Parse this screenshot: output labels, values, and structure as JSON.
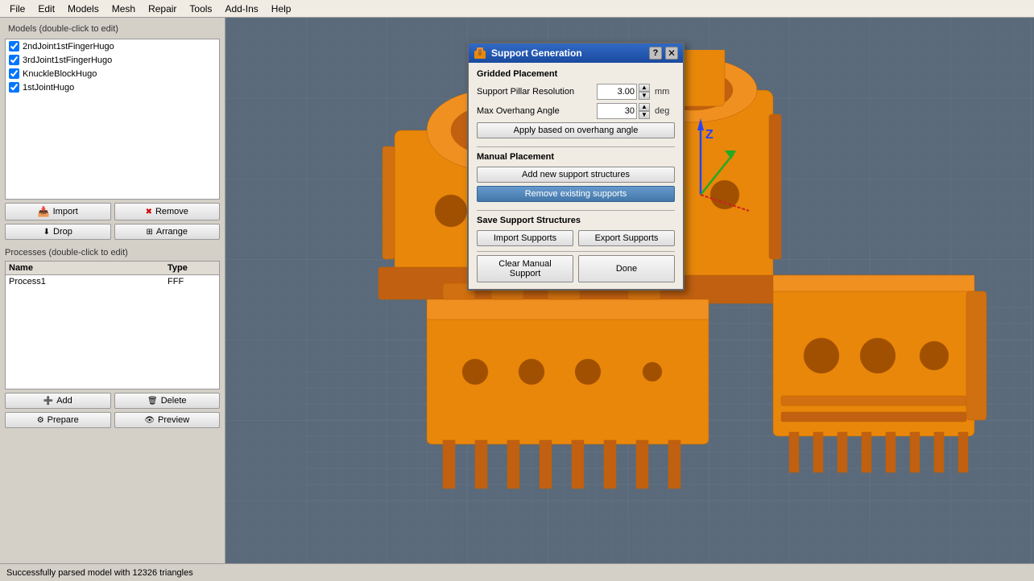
{
  "menubar": {
    "items": [
      "File",
      "Edit",
      "Models",
      "Mesh",
      "Repair",
      "Tools",
      "Add-Ins",
      "Help"
    ]
  },
  "leftpanel": {
    "models_title": "Models (double-click to edit)",
    "models": [
      {
        "label": "2ndJoint1stFingerHugo",
        "checked": true
      },
      {
        "label": "3rdJoint1stFingerHugo",
        "checked": true
      },
      {
        "label": "KnuckleBlockHugo",
        "checked": true
      },
      {
        "label": "1stJointHugo",
        "checked": true
      }
    ],
    "buttons": {
      "import": "Import",
      "remove": "Remove",
      "drop": "Drop",
      "arrange": "Arrange"
    },
    "processes_title": "Processes (double-click to edit)",
    "processes_header": {
      "name": "Name",
      "type": "Type"
    },
    "processes": [
      {
        "name": "Process1",
        "type": "FFF"
      }
    ],
    "proc_buttons": {
      "add": "Add",
      "delete": "Delete",
      "prepare": "Prepare",
      "preview": "Preview"
    }
  },
  "dialog": {
    "title": "Support Generation",
    "help_label": "?",
    "close_label": "✕",
    "gridded_placement": "Gridded Placement",
    "support_pillar_label": "Support Pillar Resolution",
    "support_pillar_value": "3.00",
    "support_pillar_unit": "mm",
    "max_overhang_label": "Max Overhang Angle",
    "max_overhang_value": "30",
    "max_overhang_unit": "deg",
    "apply_btn": "Apply based on overhang angle",
    "manual_placement": "Manual Placement",
    "add_support_btn": "Add new support structures",
    "remove_support_btn": "Remove existing supports",
    "save_section": "Save Support Structures",
    "import_supports_btn": "Import Supports",
    "export_supports_btn": "Export Supports",
    "clear_manual_btn": "Clear Manual Support",
    "done_btn": "Done"
  },
  "status": {
    "text": "Successfully parsed model with 12326 triangles"
  }
}
